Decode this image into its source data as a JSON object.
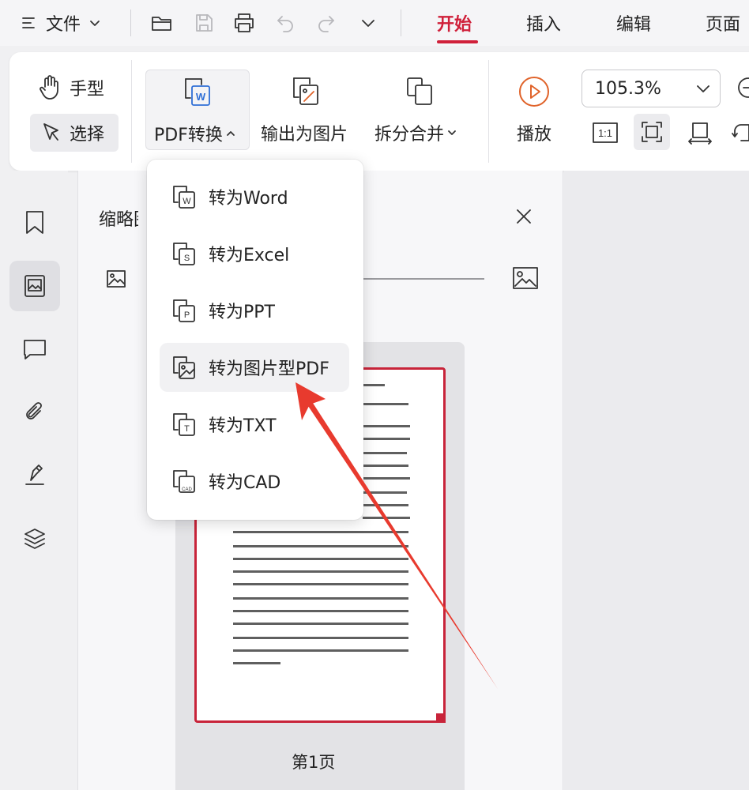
{
  "menubar": {
    "file_label": "文件",
    "tabs": [
      {
        "label": "开始",
        "active": true
      },
      {
        "label": "插入",
        "active": false
      },
      {
        "label": "编辑",
        "active": false
      },
      {
        "label": "页面",
        "active": false
      }
    ]
  },
  "ribbon": {
    "hand_label": "手型",
    "select_label": "选择",
    "pdf_convert_label": "PDF转换",
    "export_image_label": "输出为图片",
    "split_merge_label": "拆分合并",
    "play_label": "播放",
    "zoom_value": "105.3%",
    "fit_actual_label": "1:1"
  },
  "thumbnail_panel": {
    "title": "缩略图",
    "page_label": "第1页"
  },
  "dropdown": {
    "items": [
      {
        "label": "转为Word",
        "icon": "word-icon",
        "badge": "W"
      },
      {
        "label": "转为Excel",
        "icon": "excel-icon",
        "badge": "S"
      },
      {
        "label": "转为PPT",
        "icon": "ppt-icon",
        "badge": "P"
      },
      {
        "label": "转为图片型PDF",
        "icon": "image-pdf-icon",
        "hovered": true
      },
      {
        "label": "转为TXT",
        "icon": "txt-icon",
        "badge": "T"
      },
      {
        "label": "转为CAD",
        "icon": "cad-icon",
        "badge": "CAD"
      }
    ]
  },
  "colors": {
    "accent": "#d0203a",
    "annotation_arrow": "#e83a2e"
  }
}
